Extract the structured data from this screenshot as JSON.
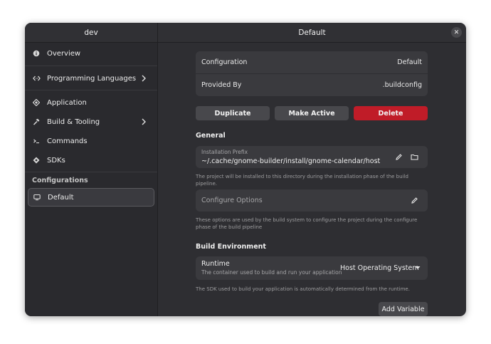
{
  "sidebar": {
    "title": "dev",
    "items": [
      {
        "label": "Overview",
        "icon": "info-icon"
      },
      {
        "label": "Programming Languages",
        "icon": "code-icon"
      },
      {
        "label": "Application",
        "icon": "application-icon"
      },
      {
        "label": "Build & Tooling",
        "icon": "hammer-icon"
      },
      {
        "label": "Commands",
        "icon": "terminal-icon"
      },
      {
        "label": "SDKs",
        "icon": "sdk-icon"
      }
    ],
    "section_label": "Configurations",
    "configurations": [
      {
        "label": "Default",
        "icon": "computer-icon"
      }
    ]
  },
  "main": {
    "title": "Default",
    "summary": {
      "configuration_label": "Configuration",
      "configuration_value": "Default",
      "provided_by_label": "Provided By",
      "provided_by_value": ".buildconfig"
    },
    "actions": {
      "duplicate": "Duplicate",
      "make_active": "Make Active",
      "delete": "Delete"
    },
    "general": {
      "title": "General",
      "prefix_label": "Installation Prefix",
      "prefix_value": "~/.cache/gnome-builder/install/gnome-calendar/host",
      "prefix_desc": "The project will be installed to this directory during the installation phase of the build pipeline.",
      "configure_options_placeholder": "Configure Options",
      "configure_options_desc": "These options are used by the build system to configure the project during the configure phase of the build pipeline"
    },
    "build_env": {
      "title": "Build Environment",
      "runtime_label": "Runtime",
      "runtime_subtitle": "The container used to build and run your application",
      "runtime_value": "Host Operating System",
      "sdk_desc": "The SDK used to build your application is automatically determined from the runtime.",
      "add_variable": "Add Variable"
    }
  },
  "colors": {
    "window_bg": "#2e2e32",
    "sidebar_bg": "#2a2a2e",
    "card_bg": "#3a3a3e",
    "button_bg": "#48484c",
    "danger": "#c01c28"
  }
}
